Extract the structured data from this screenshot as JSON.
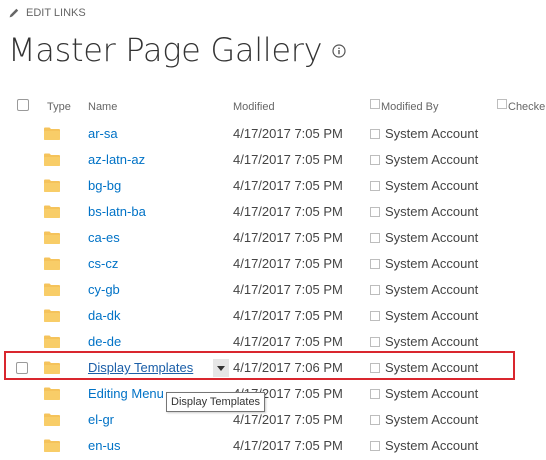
{
  "header": {
    "edit_links_label": "EDIT LINKS",
    "page_title": "Master Page Gallery"
  },
  "columns": {
    "type": "Type",
    "name": "Name",
    "modified": "Modified",
    "modified_by": "Modified By",
    "checked_out": "Checke"
  },
  "rows": [
    {
      "name": "ar-sa",
      "modified": "4/17/2017 7:05 PM",
      "modified_by": "System Account"
    },
    {
      "name": "az-latn-az",
      "modified": "4/17/2017 7:05 PM",
      "modified_by": "System Account"
    },
    {
      "name": "bg-bg",
      "modified": "4/17/2017 7:05 PM",
      "modified_by": "System Account"
    },
    {
      "name": "bs-latn-ba",
      "modified": "4/17/2017 7:05 PM",
      "modified_by": "System Account"
    },
    {
      "name": "ca-es",
      "modified": "4/17/2017 7:05 PM",
      "modified_by": "System Account"
    },
    {
      "name": "cs-cz",
      "modified": "4/17/2017 7:05 PM",
      "modified_by": "System Account"
    },
    {
      "name": "cy-gb",
      "modified": "4/17/2017 7:05 PM",
      "modified_by": "System Account"
    },
    {
      "name": "da-dk",
      "modified": "4/17/2017 7:05 PM",
      "modified_by": "System Account"
    },
    {
      "name": "de-de",
      "modified": "4/17/2017 7:05 PM",
      "modified_by": "System Account"
    },
    {
      "name": "Display Templates",
      "modified": "4/17/2017 7:06 PM",
      "modified_by": "System Account",
      "selected": true
    },
    {
      "name": "Editing Menu",
      "modified": "4/17/2017 7:05 PM",
      "modified_by": "System Account"
    },
    {
      "name": "el-gr",
      "modified": "4/17/2017 7:05 PM",
      "modified_by": "System Account"
    },
    {
      "name": "en-us",
      "modified": "4/17/2017 7:05 PM",
      "modified_by": "System Account"
    }
  ],
  "tooltip": "Display Templates",
  "colors": {
    "link": "#0072c6",
    "folder": "#f5c35b",
    "highlight": "#d9262e"
  }
}
